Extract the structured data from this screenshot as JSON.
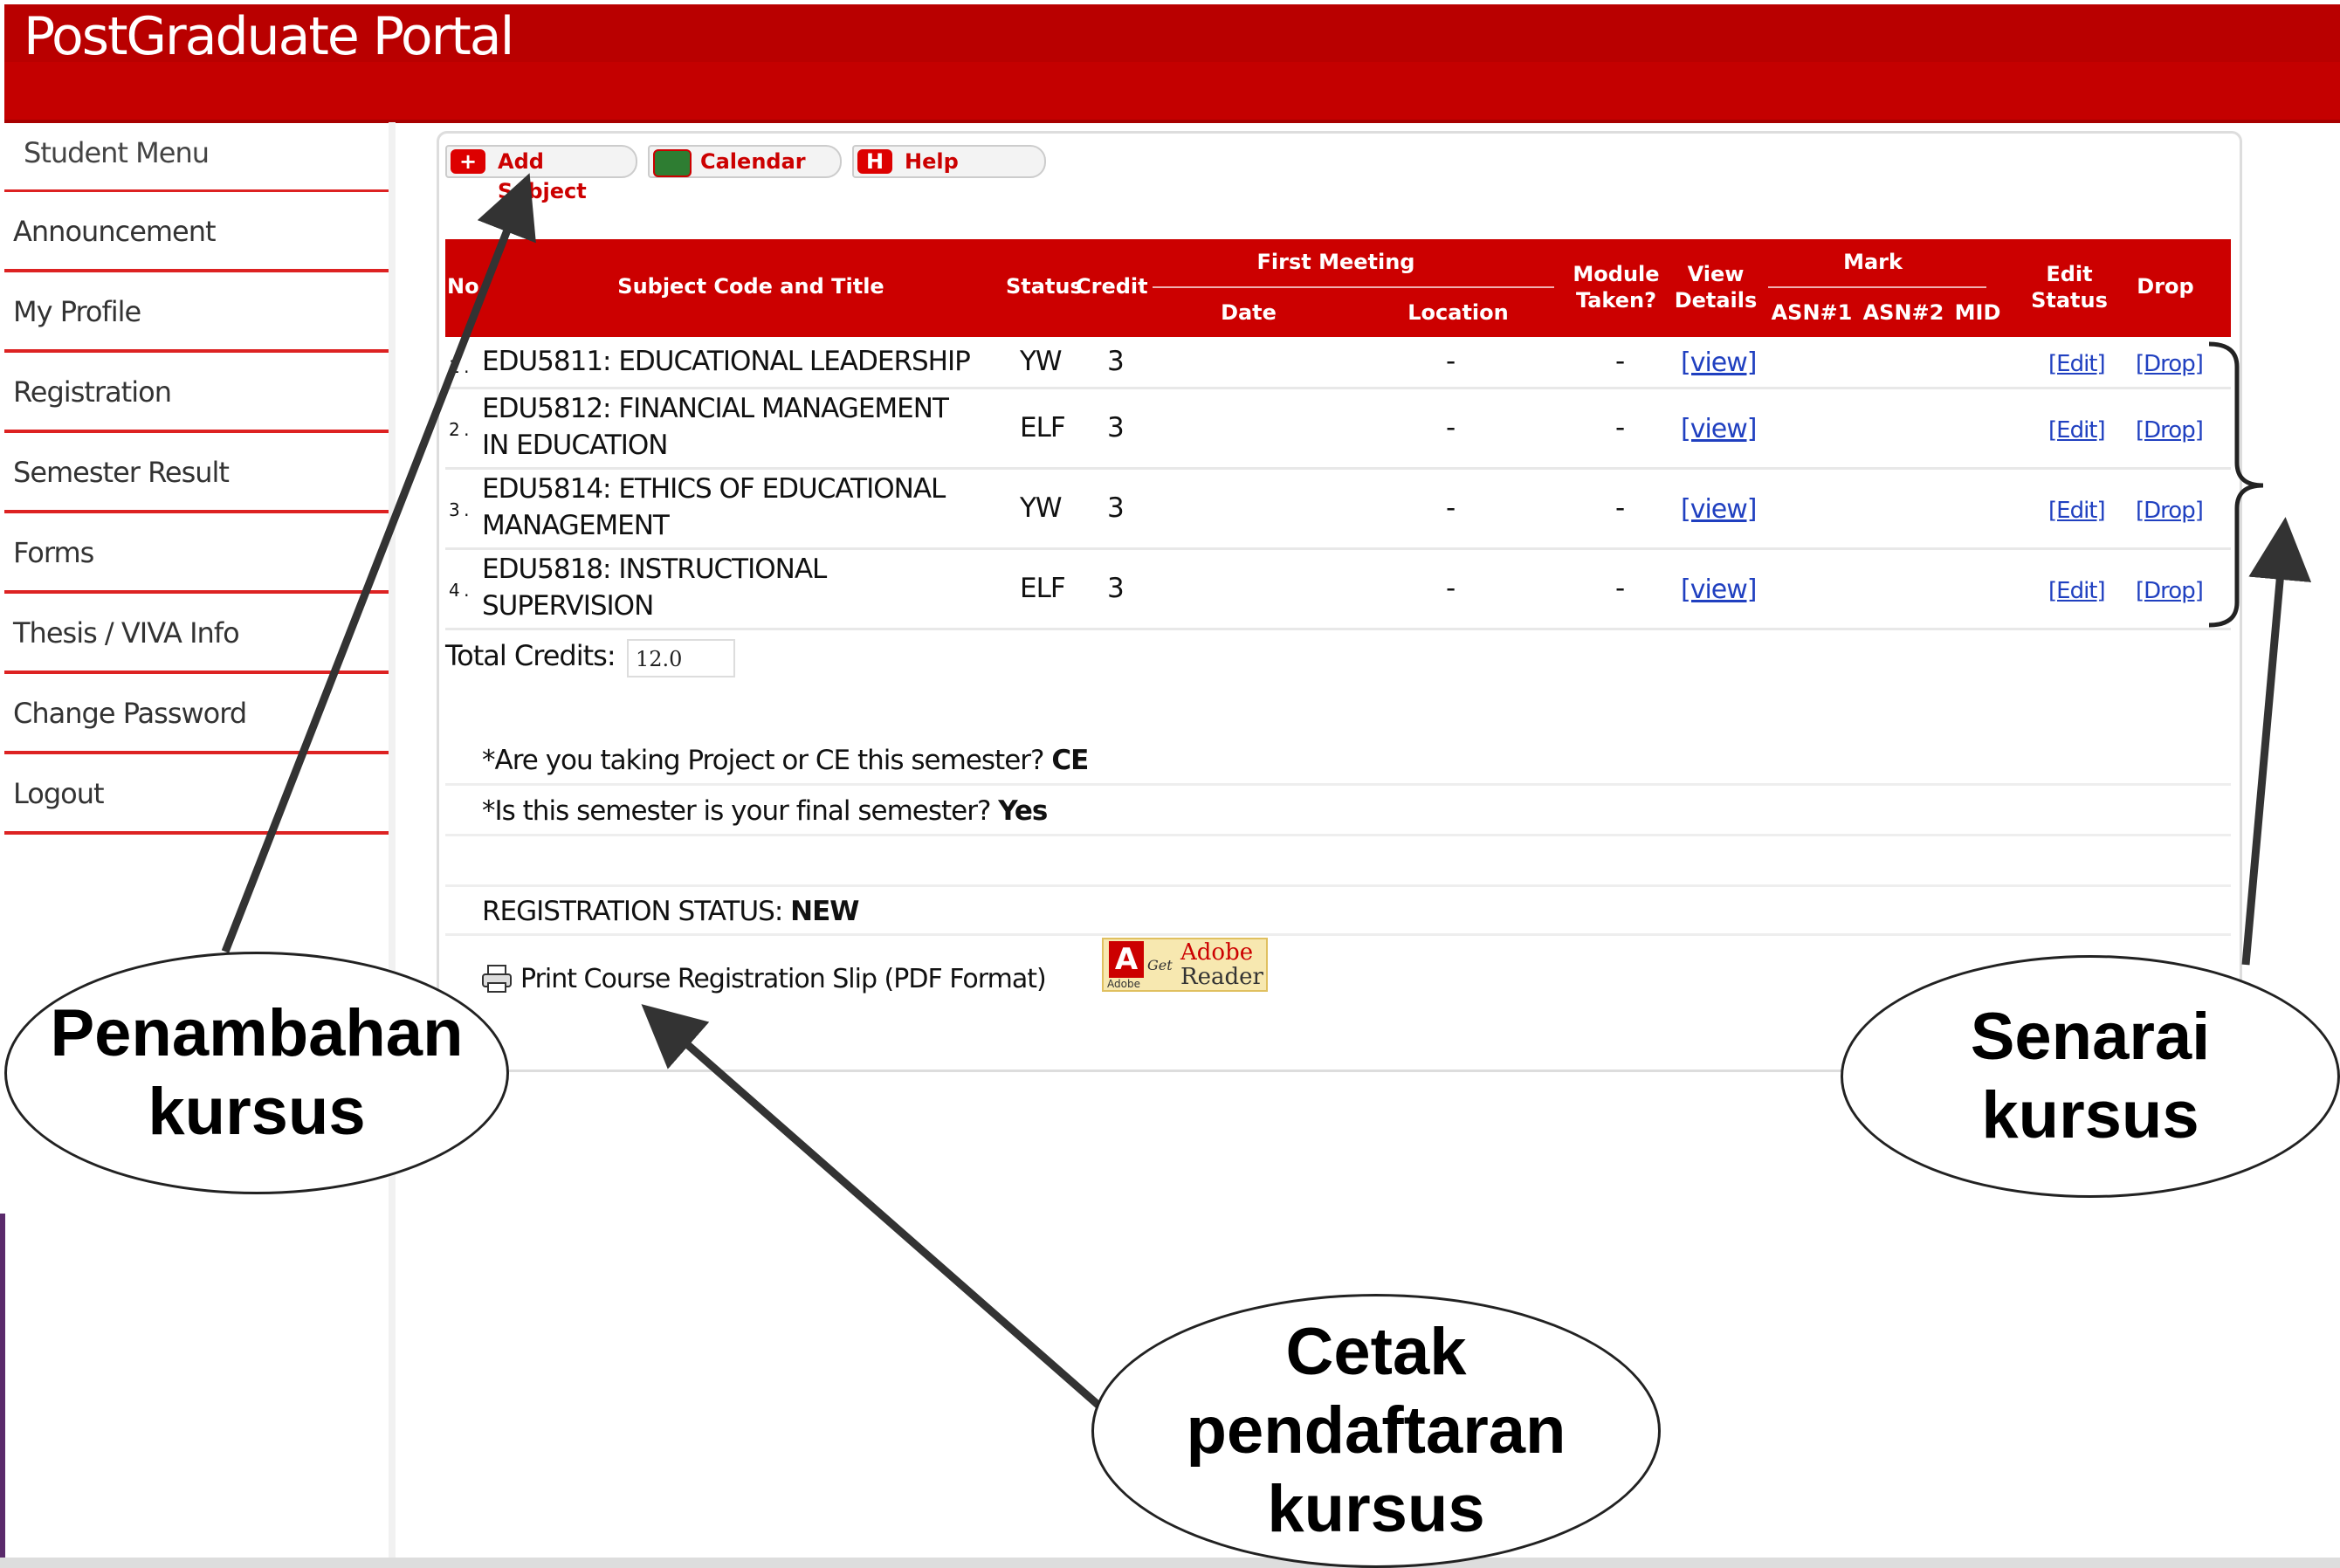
{
  "header": {
    "title": "PostGraduate Portal"
  },
  "sidebar": {
    "heading": "Student Menu",
    "items": [
      {
        "label": "Announcement"
      },
      {
        "label": "My Profile"
      },
      {
        "label": "Registration"
      },
      {
        "label": "Semester Result"
      },
      {
        "label": "Forms"
      },
      {
        "label": "Thesis / VIVA Info"
      },
      {
        "label": "Change Password"
      },
      {
        "label": "Logout"
      }
    ]
  },
  "toolbar": {
    "add_subject": "Add Subject",
    "calendar": "Calendar",
    "help": "Help",
    "help_icon_letter": "H"
  },
  "table": {
    "headers": {
      "no": "No",
      "subject": "Subject Code and Title",
      "status": "Status",
      "credit": "Credit",
      "first_meeting": "First Meeting",
      "date": "Date",
      "location": "Location",
      "module_taken_1": "Module",
      "module_taken_2": "Taken?",
      "view_details_1": "View",
      "view_details_2": "Details",
      "mark": "Mark",
      "asn1": "ASN#1",
      "asn2": "ASN#2",
      "mid": "MID",
      "edit_status_1": "Edit",
      "edit_status_2": "Status",
      "drop": "Drop"
    },
    "rows": [
      {
        "no": "1 .",
        "subject_line1": "EDU5811: EDUCATIONAL LEADERSHIP",
        "subject_line2": "",
        "status": "YW",
        "credit": "3",
        "location": "-",
        "module_taken": "-",
        "view": "[view]",
        "edit": "[Edit]",
        "drop": "[Drop]"
      },
      {
        "no": "2 .",
        "subject_line1": "EDU5812: FINANCIAL MANAGEMENT",
        "subject_line2": "IN EDUCATION",
        "status": "ELF",
        "credit": "3",
        "location": "-",
        "module_taken": "-",
        "view": "[view]",
        "edit": "[Edit]",
        "drop": "[Drop]"
      },
      {
        "no": "3 .",
        "subject_line1": "EDU5814: ETHICS OF EDUCATIONAL",
        "subject_line2": "MANAGEMENT",
        "status": "YW",
        "credit": "3",
        "location": "-",
        "module_taken": "-",
        "view": "[view]",
        "edit": "[Edit]",
        "drop": "[Drop]"
      },
      {
        "no": "4 .",
        "subject_line1": "EDU5818: INSTRUCTIONAL",
        "subject_line2": "SUPERVISION",
        "status": "ELF",
        "credit": "3",
        "location": "-",
        "module_taken": "-",
        "view": "[view]",
        "edit": "[Edit]",
        "drop": "[Drop]"
      }
    ]
  },
  "total": {
    "label": "Total Credits:",
    "value": "12.0"
  },
  "questions": [
    {
      "text": "*Are you taking Project or CE this semester?",
      "answer": "CE"
    },
    {
      "text": "*Is this semester is your final semester?",
      "answer": "Yes"
    }
  ],
  "registration_status": {
    "label": "REGISTRATION STATUS:",
    "value": "NEW"
  },
  "print": {
    "label": "Print Course Registration Slip (PDF Format)",
    "adobe_get": "Get",
    "adobe_line1": "Adobe",
    "adobe_line2": "Reader",
    "adobe_small": "Adobe"
  },
  "callouts": {
    "add_course_1": "Penambahan",
    "add_course_2": "kursus",
    "course_list_1": "Senarai",
    "course_list_2": "kursus",
    "print_reg_1": "Cetak",
    "print_reg_2": "pendaftaran",
    "print_reg_3": "kursus"
  },
  "colors": {
    "brand_red": "#c40000",
    "link_blue": "#2040c0"
  }
}
